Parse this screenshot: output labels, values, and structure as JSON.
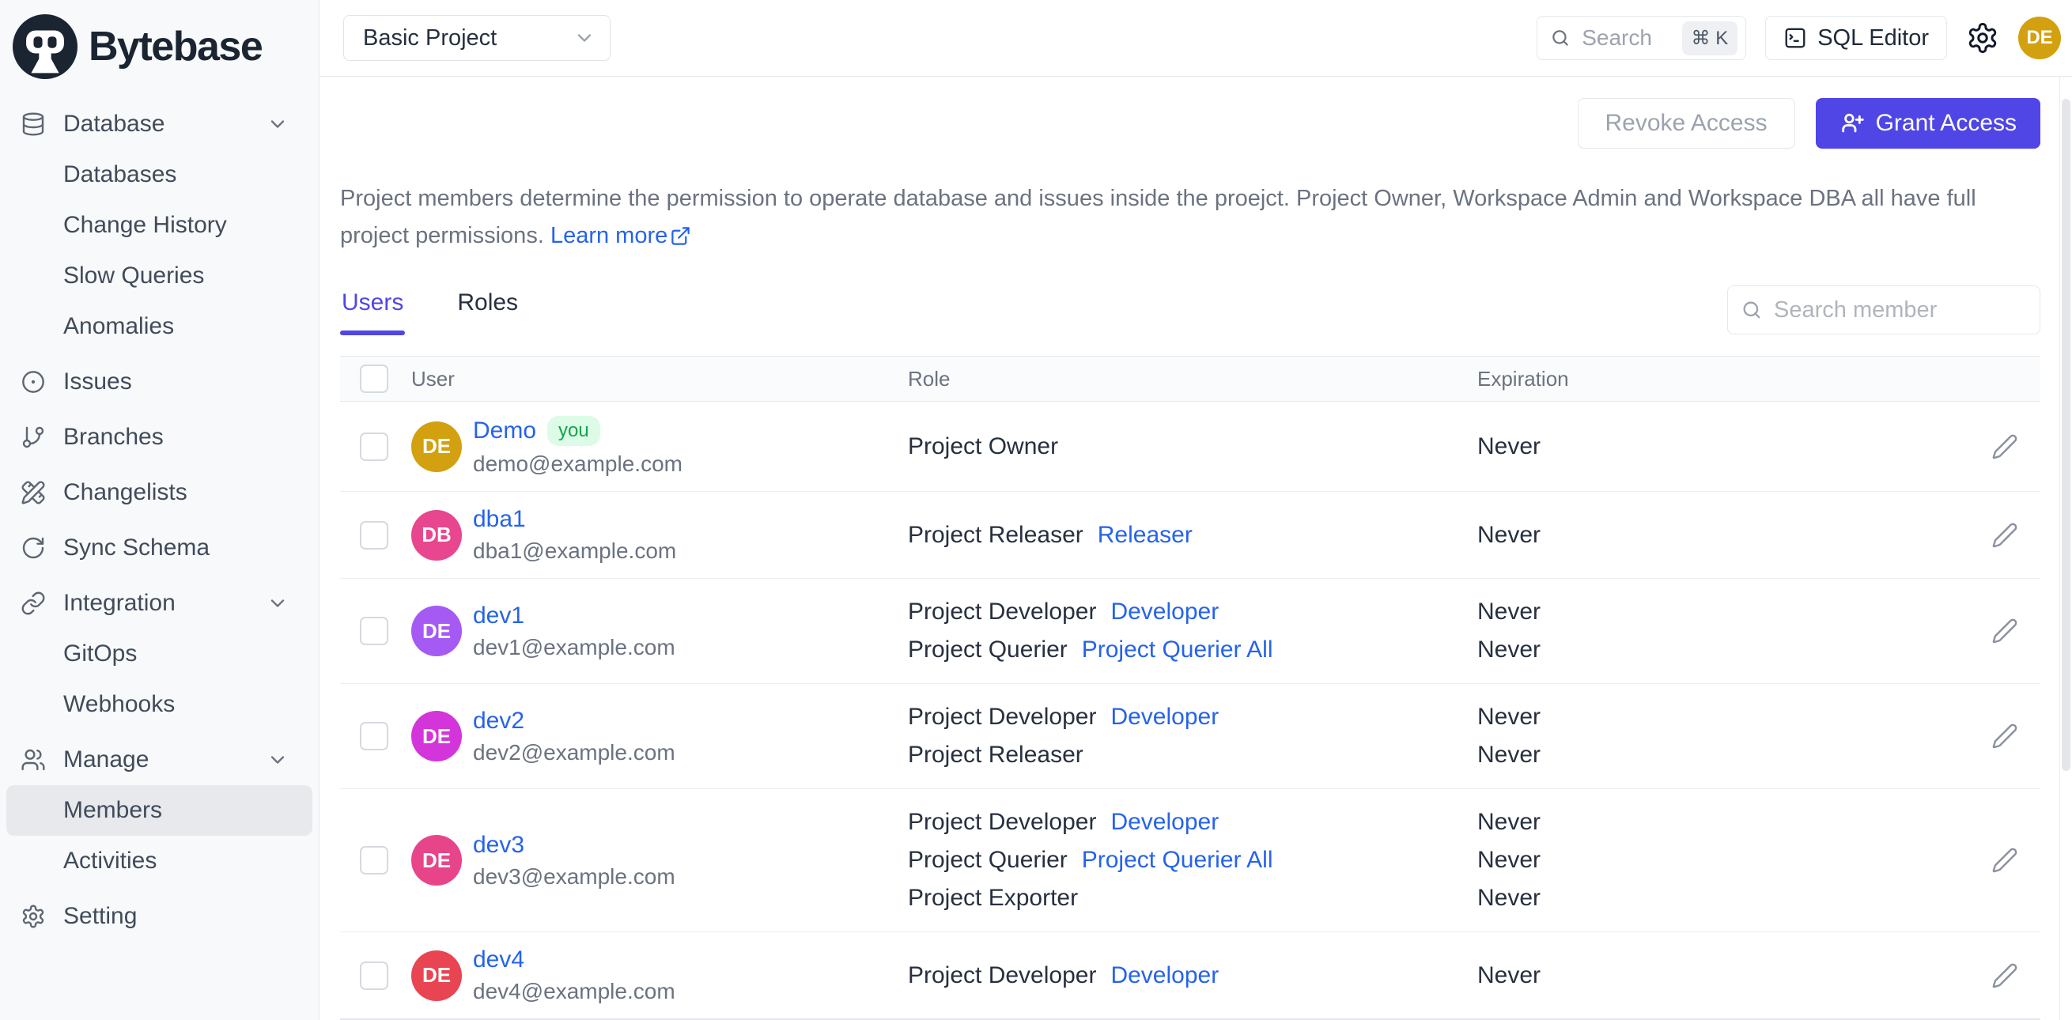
{
  "brand": {
    "name": "Bytebase"
  },
  "topbar": {
    "project_select": "Basic Project",
    "search_placeholder": "Search",
    "search_shortcut": "⌘ K",
    "sql_editor_label": "SQL Editor",
    "avatar_initials": "DE",
    "avatar_color": "#d3a00f"
  },
  "sidebar": {
    "database": {
      "label": "Database"
    },
    "database_items": [
      "Databases",
      "Change History",
      "Slow Queries",
      "Anomalies"
    ],
    "issues": "Issues",
    "branches": "Branches",
    "changelists": "Changelists",
    "sync_schema": "Sync Schema",
    "integration": {
      "label": "Integration"
    },
    "integration_items": [
      "GitOps",
      "Webhooks"
    ],
    "manage": {
      "label": "Manage"
    },
    "manage_items": [
      "Members",
      "Activities"
    ],
    "setting": "Setting"
  },
  "page": {
    "revoke_button": "Revoke Access",
    "grant_button": "Grant Access",
    "description_line1": "Project members determine the permission to operate database and issues inside the proejct. Project Owner, Workspace Admin and Workspace DBA all have full",
    "description_line2": "project permissions.",
    "learn_more": "Learn more",
    "tabs": [
      "Users",
      "Roles"
    ],
    "member_search_placeholder": "Search member",
    "columns": [
      "User",
      "Role",
      "Expiration"
    ]
  },
  "members": [
    {
      "initials": "DE",
      "color": "#d3a00f",
      "name": "Demo",
      "badge": "you",
      "email": "demo@example.com",
      "roles": [
        {
          "text": "Project Owner"
        }
      ],
      "expirations": [
        "Never"
      ]
    },
    {
      "initials": "DB",
      "color": "#e8468f",
      "name": "dba1",
      "email": "dba1@example.com",
      "roles": [
        {
          "text": "Project Releaser",
          "link": "Releaser"
        }
      ],
      "expirations": [
        "Never"
      ]
    },
    {
      "initials": "DE",
      "color": "#a55af4",
      "name": "dev1",
      "email": "dev1@example.com",
      "roles": [
        {
          "text": "Project Developer",
          "link": "Developer"
        },
        {
          "text": "Project Querier",
          "link": "Project Querier All"
        }
      ],
      "expirations": [
        "Never",
        "Never"
      ]
    },
    {
      "initials": "DE",
      "color": "#d435db",
      "name": "dev2",
      "email": "dev2@example.com",
      "roles": [
        {
          "text": "Project Developer",
          "link": "Developer"
        },
        {
          "text": "Project Releaser"
        }
      ],
      "expirations": [
        "Never",
        "Never"
      ]
    },
    {
      "initials": "DE",
      "color": "#e8448a",
      "name": "dev3",
      "email": "dev3@example.com",
      "roles": [
        {
          "text": "Project Developer",
          "link": "Developer"
        },
        {
          "text": "Project Querier",
          "link": "Project Querier All"
        },
        {
          "text": "Project Exporter"
        }
      ],
      "expirations": [
        "Never",
        "Never",
        "Never"
      ]
    },
    {
      "initials": "DE",
      "color": "#e94452",
      "name": "dev4",
      "email": "dev4@example.com",
      "roles": [
        {
          "text": "Project Developer",
          "link": "Developer"
        }
      ],
      "expirations": [
        "Never"
      ]
    }
  ],
  "colors": {
    "accent": "#4f46e5",
    "link": "#2563eb",
    "you_badge_bg": "#dcfce7",
    "you_badge_text": "#16a34a"
  }
}
